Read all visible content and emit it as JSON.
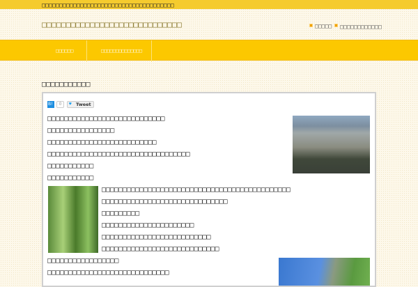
{
  "topbar": {
    "text": "□□□□□□□□□□□□□□□□□□□□□□□□□□□□□□□□□□□□□□"
  },
  "header": {
    "site_title": "□□□□□□□□□□□□□□□□□□□□□□□□□□□□□",
    "links": [
      "□□□□□",
      "□□□□□□□□□□□□"
    ]
  },
  "nav": {
    "items": [
      "□□□□□□",
      "□□□□□□□□□□□□□□"
    ]
  },
  "page": {
    "heading": "□□□□□□□□□□□",
    "share": {
      "hatena_label": "B!",
      "count": "0",
      "tweet_label": "Tweet"
    },
    "paragraphs_top": [
      "□□□□□□□□□□□□□□□□□□□□□□□□□□□□",
      "□□□□□□□□□□□□□□□□",
      "□□□□□□□□□□□□□□□□□□□□□□□□□□",
      "□□□□□□□□□□□□□□□□□□□□□□□□□□□□□□□□□□",
      "□□□□□□□□□□□",
      "□□□□□□□□□□□"
    ],
    "paragraphs_mid": [
      "□□□□□□□□□□□□□□□□□□□□□□□□□□□□□□□□□□□□□□□□□□□□□",
      "□□□□□□□□□□□□□□□□□□□□□□□□□□□□□□",
      "□□□□□□□□□",
      "□□□□□□□□□□□□□□□□□□□□□□",
      "□□□□□□□□□□□□□□□□□□□□□□□□□□",
      "□□□□□□□□□□□□□□□□□□□□□□□□□□□□"
    ],
    "paragraphs_bottom": [
      "□□□□□□□□□□□□□□□□□",
      "□□□□□□□□□□□□□□□□□□□□□□□□□□□□□"
    ]
  }
}
